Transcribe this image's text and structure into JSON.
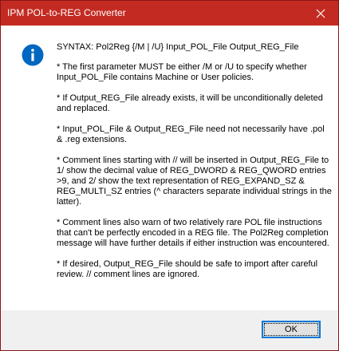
{
  "window": {
    "title": "IPM POL-to-REG Converter"
  },
  "message": {
    "icon": "info-icon",
    "paragraphs": [
      "SYNTAX:  Pol2Reg {/M | /U} Input_POL_File Output_REG_File",
      "* The first parameter MUST be either /M or /U to specify whether Input_POL_File contains Machine or User policies.",
      "* If Output_REG_File already exists, it will be unconditionally deleted and replaced.",
      "* Input_POL_File & Output_REG_File need not necessarily have .pol & .reg extensions.",
      "* Comment lines starting with // will be inserted in Output_REG_File to 1/ show the decimal value of REG_DWORD & REG_QWORD entries >9, and 2/ show the text representation of REG_EXPAND_SZ & REG_MULTI_SZ entries (^ characters separate individual strings in the latter).",
      "* Comment lines also warn of two relatively rare POL file instructions that can't be perfectly encoded in a REG file. The Pol2Reg completion message will have further details if either instruction was encountered.",
      "* If desired, Output_REG_File should be safe to import after careful review. // comment lines are ignored."
    ]
  },
  "buttons": {
    "ok_label": "OK"
  },
  "colors": {
    "titlebar": "#c32b22",
    "info_icon": "#0067c0",
    "button_focus": "#0078d7"
  }
}
